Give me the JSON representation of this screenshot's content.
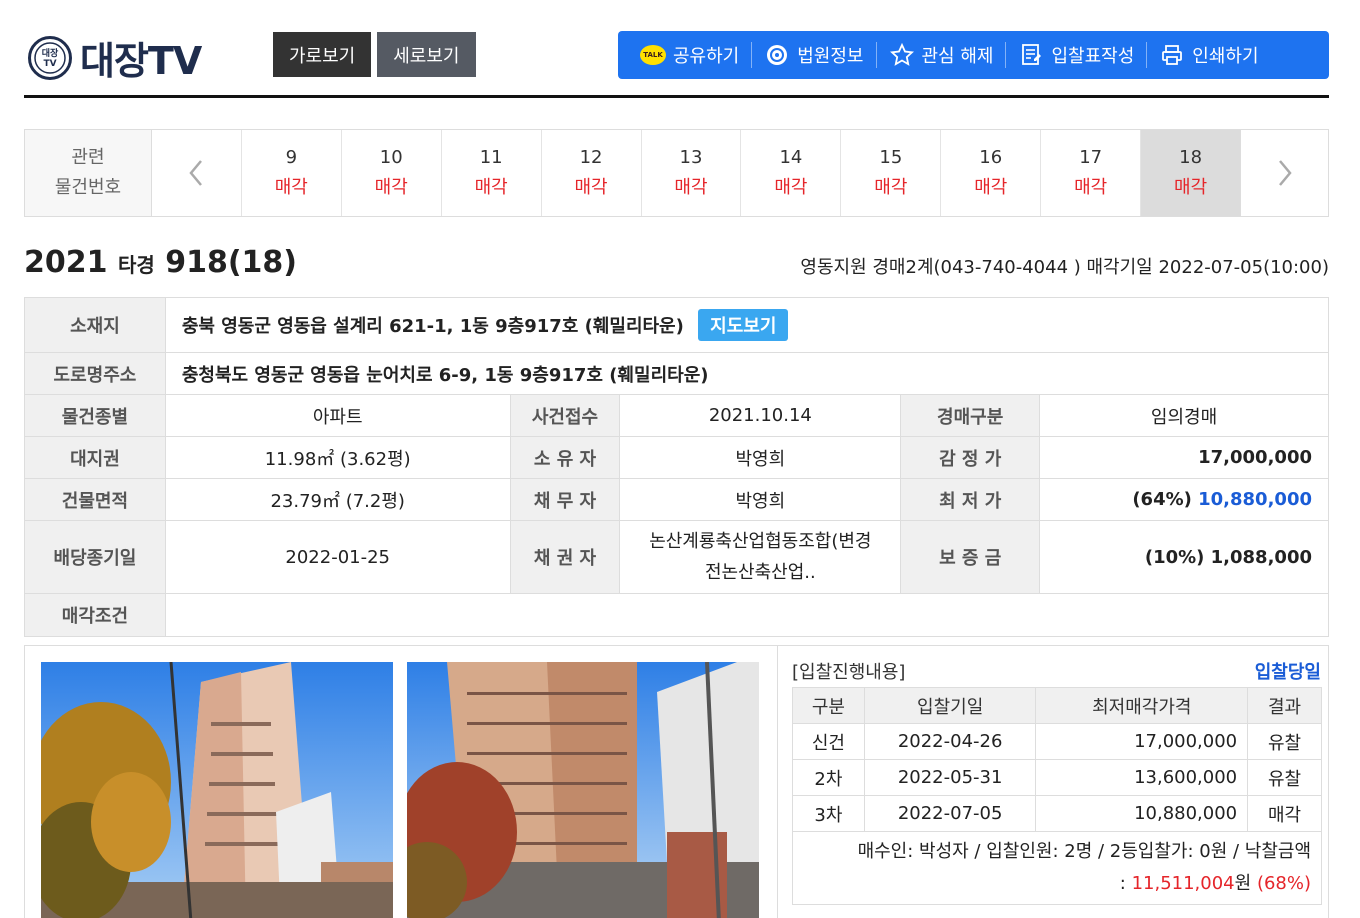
{
  "header": {
    "logo_badge": "대장TV",
    "logo_text": "대장TV",
    "view_tabs": [
      "가로보기",
      "세로보기"
    ],
    "tools": [
      {
        "label": "공유하기",
        "icon": "kakaotalk-icon"
      },
      {
        "label": "법원정보",
        "icon": "court-icon"
      },
      {
        "label": "관심 해제",
        "icon": "star-icon"
      },
      {
        "label": "입찰표작성",
        "icon": "form-icon"
      },
      {
        "label": "인쇄하기",
        "icon": "print-icon"
      }
    ],
    "talk_badge": "TALK"
  },
  "related": {
    "label_line1": "관련",
    "label_line2": "물건번호",
    "items": [
      {
        "num": "9",
        "status": "매각"
      },
      {
        "num": "10",
        "status": "매각"
      },
      {
        "num": "11",
        "status": "매각"
      },
      {
        "num": "12",
        "status": "매각"
      },
      {
        "num": "13",
        "status": "매각"
      },
      {
        "num": "14",
        "status": "매각"
      },
      {
        "num": "15",
        "status": "매각"
      },
      {
        "num": "16",
        "status": "매각"
      },
      {
        "num": "17",
        "status": "매각"
      },
      {
        "num": "18",
        "status": "매각"
      }
    ],
    "active_num": "18"
  },
  "case": {
    "year": "2021",
    "type": "타경",
    "number": "918(18)",
    "court_info": "영동지원 경매2계(043-740-4044 ) 매각기일 2022-07-05(10:00)"
  },
  "info": {
    "location_label": "소재지",
    "location": "충북 영동군 영동읍 설계리 621-1, 1동 9층917호 (훼밀리타운)",
    "map_button": "지도보기",
    "road_label": "도로명주소",
    "road": "충청북도 영동군 영동읍 눈어치로 6-9, 1동 9층917호 (훼밀리타운)",
    "rows": [
      {
        "h1": "물건종별",
        "v1": "아파트",
        "h2": "사건접수",
        "v2": "2021.10.14",
        "h3": "경매구분",
        "v3": "임의경매"
      },
      {
        "h1": "대지권",
        "v1": "11.98㎡ (3.62평)",
        "h2": "소 유 자",
        "v2": "박영희",
        "h3": "감 정 가",
        "v3": "17,000,000"
      },
      {
        "h1": "건물면적",
        "v1": "23.79㎡ (7.2평)",
        "h2": "채 무 자",
        "v2": "박영희",
        "h3": "최 저 가",
        "v3_prefix": "(64%) ",
        "v3": "10,880,000"
      },
      {
        "h1": "배당종기일",
        "v1": "2022-01-25",
        "h2": "채 권 자",
        "v2_line1": "논산계룡축산업협동조합(변경",
        "v2_line2": "전논산축산업..",
        "h3": "보 증 금",
        "v3": "(10%) 1,088,000"
      }
    ],
    "condition_label": "매각조건",
    "condition": ""
  },
  "bid_panel": {
    "title": "[입찰진행내용]",
    "link": "입찰당일",
    "headers": [
      "구분",
      "입찰기일",
      "최저매각가격",
      "결과"
    ],
    "rows": [
      {
        "round": "신건",
        "date": "2022-04-26",
        "price": "17,000,000",
        "result": "유찰"
      },
      {
        "round": "2차",
        "date": "2022-05-31",
        "price": "13,600,000",
        "result": "유찰"
      },
      {
        "round": "3차",
        "date": "2022-07-05",
        "price": "10,880,000",
        "result": "매각"
      }
    ],
    "note_line1": "매수인: 박성자 / 입찰인원: 2명 / 2등입찰가: 0원 / 낙찰금액",
    "note_prefix": ": ",
    "note_amount": "11,511,004",
    "note_unit": "원",
    "note_rate": "(68%)"
  },
  "colors": {
    "accent_blue": "#1e73f0",
    "status_red": "#e5252a",
    "link_blue": "#1a5cd6",
    "map_button": "#3aa7f0"
  }
}
